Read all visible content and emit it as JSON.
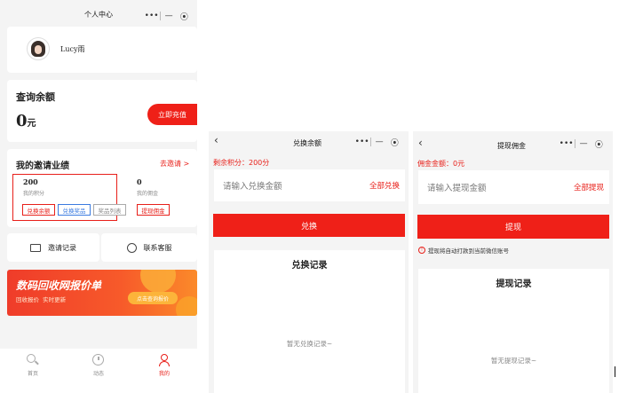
{
  "profile": {
    "nav_title": "个人中心",
    "user_name": "Lucy雨",
    "balance_title": "查询余额",
    "balance_value": "0",
    "balance_unit": "元",
    "withdraw_button": "立即充值",
    "invite_title": "我的邀请业绩",
    "invite_link": "去邀请 >",
    "points_value": "200",
    "points_label": "我的积分",
    "commission_value": "0",
    "commission_label": "我的佣金",
    "tags": [
      "兑换余额",
      "兑换奖品",
      "奖品列表"
    ],
    "commission_tag": "提现佣金",
    "invite_records": "邀请记录",
    "contact_service": "联系客服",
    "banner_title": "数码回收网报价单",
    "banner_subtitle": "回收报价  实时更新",
    "banner_button": "点击查询报价",
    "tabs": [
      "首页",
      "动态",
      "我的"
    ]
  },
  "exchange": {
    "nav_title": "兑换余额",
    "remaining_points": "剩余积分：200分",
    "input_placeholder": "请输入兑换金额",
    "all_link": "全部兑换",
    "submit_button": "兑换",
    "records_title": "兑换记录",
    "empty_text": "暂无兑换记录~"
  },
  "withdraw": {
    "nav_title": "提现佣金",
    "commission_amount": "佣金金额：0元",
    "input_placeholder": "请输入提现金额",
    "all_link": "全部提现",
    "submit_button": "提现",
    "notice": "提现将自动打款到当前微信账号",
    "records_title": "提现记录",
    "empty_text": "暂无提现记录~"
  },
  "colors": {
    "accent": "#ef2018",
    "tag_blue": "#3b7be0",
    "tag_gray": "#999999"
  }
}
